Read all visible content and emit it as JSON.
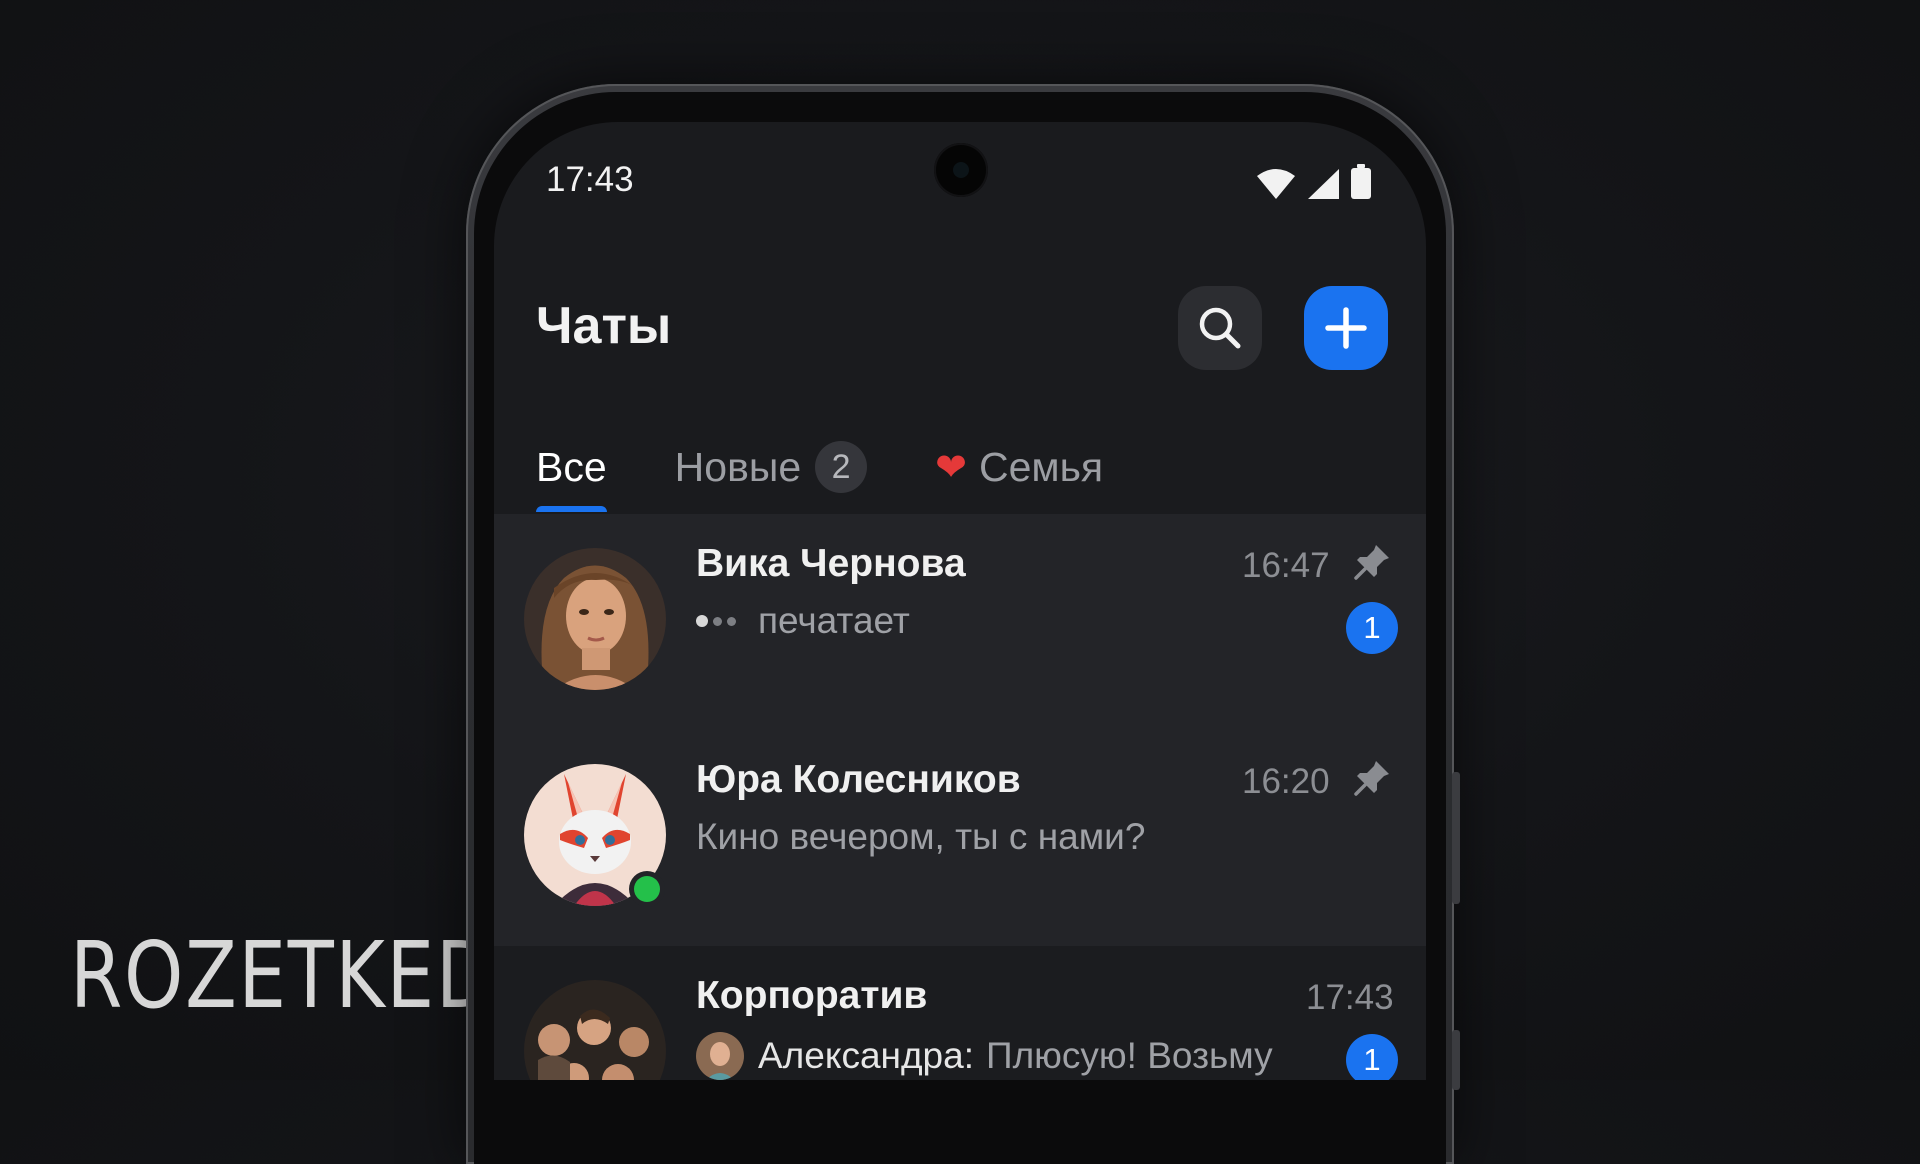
{
  "watermark": "ROZETKED",
  "status_bar": {
    "time": "17:43",
    "icons": [
      "wifi-icon",
      "signal-icon",
      "battery-icon"
    ]
  },
  "header": {
    "title": "Чаты",
    "search_icon": "search-icon",
    "add_icon": "plus-icon"
  },
  "tabs": [
    {
      "label": "Все",
      "active": true
    },
    {
      "label": "Новые",
      "badge": "2"
    },
    {
      "label": "Семья",
      "emoji": "❤"
    }
  ],
  "chats": [
    {
      "name": "Вика Чернова",
      "message": "печатает",
      "time": "16:47",
      "pinned": true,
      "unread": "1",
      "typing": true
    },
    {
      "name": "Юра Колесников",
      "message": "Кино вечером, ты с нами?",
      "time": "16:20",
      "pinned": true,
      "online": true
    },
    {
      "name": "Корпоратив",
      "sender": "Александра:",
      "message": "Плюсую! Возьму",
      "time": "17:43",
      "unread": "1"
    }
  ],
  "colors": {
    "accent": "#1a73f0",
    "online": "#24c04a",
    "background": "#1a1b1e"
  }
}
